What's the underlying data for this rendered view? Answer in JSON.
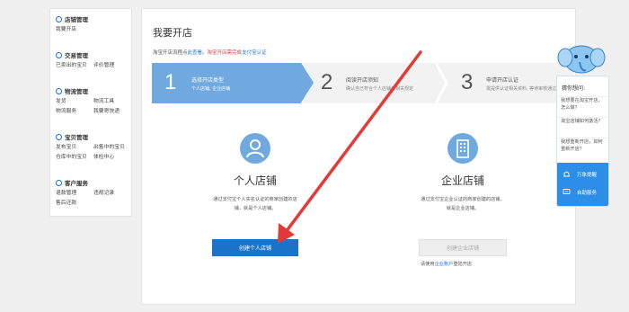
{
  "sidebar": {
    "groups": [
      {
        "title": "店铺管理",
        "rows": [
          [
            "我要开店"
          ]
        ]
      },
      {
        "title": "交易管理",
        "rows": [
          [
            "已卖出的宝贝",
            "评价管理"
          ]
        ]
      },
      {
        "title": "物流管理",
        "rows": [
          [
            "发货",
            "物流工具"
          ],
          [
            "物流服务",
            "我要寄快递"
          ]
        ]
      },
      {
        "title": "宝贝管理",
        "rows": [
          [
            "发布宝贝",
            "出售中的宝贝"
          ],
          [
            "仓库中的宝贝",
            "体检中心"
          ]
        ]
      },
      {
        "title": "客户服务",
        "rows": [
          [
            "退款管理",
            "违规记录"
          ],
          [
            "售后还款"
          ]
        ]
      }
    ]
  },
  "main": {
    "title": "我要开店",
    "notice": {
      "prefix": "淘宝开店流程点",
      "link1": "此查看",
      "sep": "。",
      "red": "淘宝开店需完成",
      "link2": "支付宝认证"
    },
    "steps": [
      {
        "num": "1",
        "title": "选择开店类型",
        "desc": "个人店铺, 企业店铺"
      },
      {
        "num": "2",
        "title": "阅读开店须知",
        "desc": "确认自己符合个人店铺的相关规定"
      },
      {
        "num": "3",
        "title": "申请开店认证",
        "desc": "需提供认证相关资料, 等待审核通过"
      }
    ],
    "personal": {
      "name": "个人店铺",
      "desc": "通过支付宝个人实名认证的商家创建的店铺，就是个人店铺。",
      "button": "创建个人店铺"
    },
    "enterprise": {
      "name": "企业店铺",
      "desc": "通过支付宝企业认证的商家创建的店铺，就是企业店铺。",
      "button": "创建企业店铺",
      "hint_prefix": "请使用",
      "hint_link": "企业账户",
      "hint_suffix": "登陆开店"
    }
  },
  "helper": {
    "head": "猜你想问:",
    "faqs": [
      "我想要在淘宝开店，怎么做？",
      "淘宝店铺如何激活？",
      "我想重新开店，如何重新开店？"
    ],
    "items": [
      "万象提醒",
      "自助服务"
    ]
  },
  "colors": {
    "accent": "#1a73c8",
    "step_active": "#6fa9e0",
    "arrow": "#e53935"
  }
}
